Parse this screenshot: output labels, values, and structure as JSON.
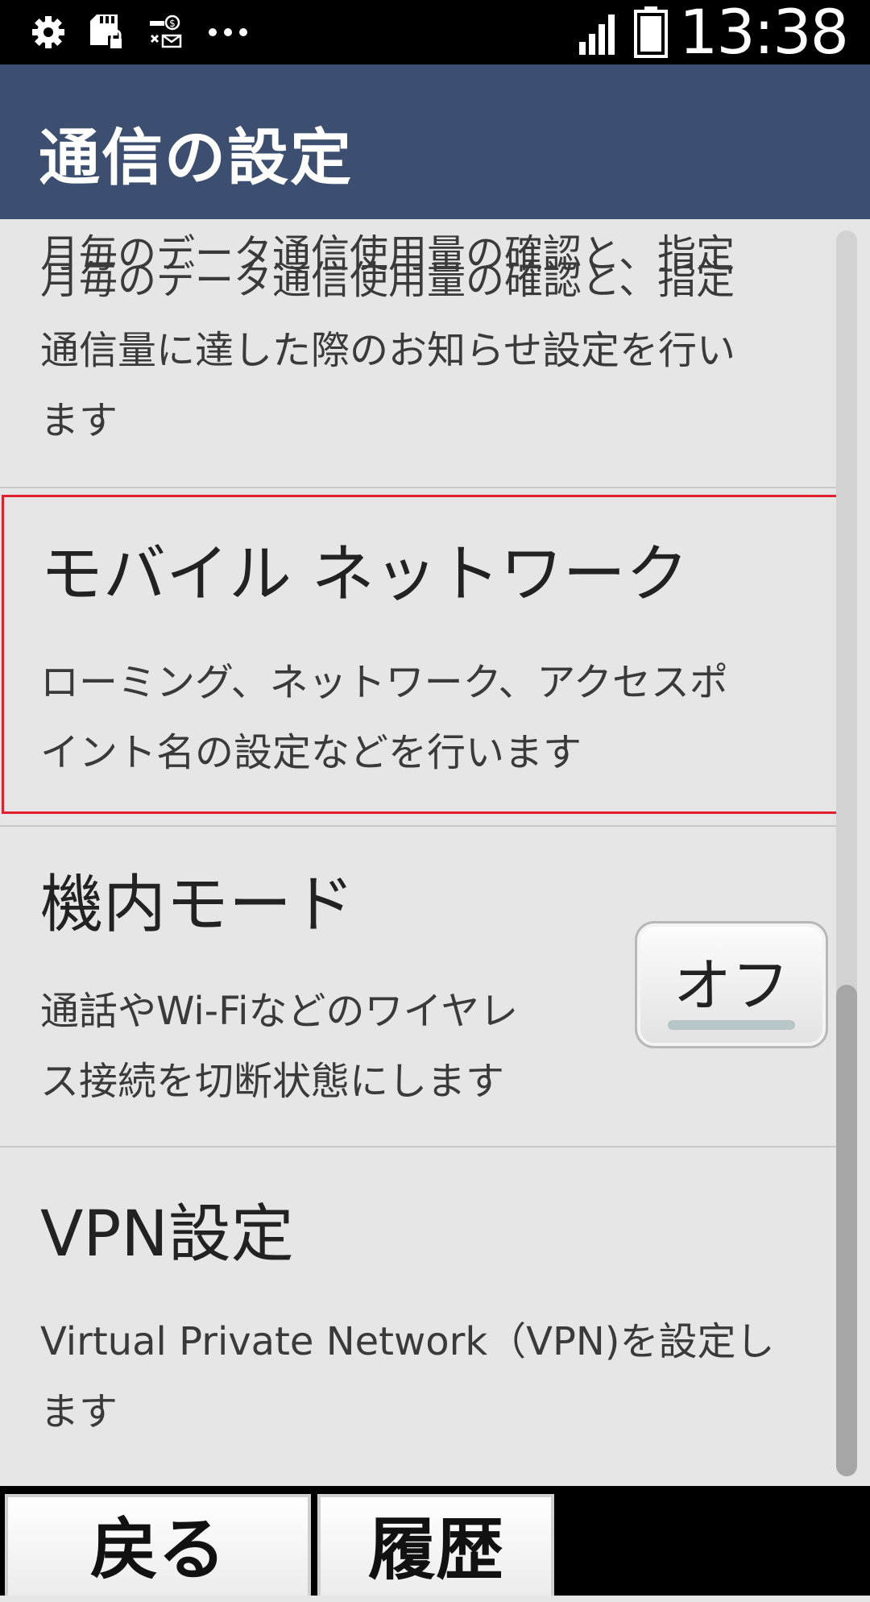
{
  "status_bar": {
    "time": "13:38",
    "icons": [
      "gear-icon",
      "sd-card-lock-icon",
      "key-money-icon",
      "more-dots-icon",
      "signal-icon",
      "battery-icon"
    ]
  },
  "header": {
    "title": "通信の設定"
  },
  "items": [
    {
      "desc_line1": "月毎のデータ通信使用量の確認と、指定",
      "desc_line2": "通信量に達した際のお知らせ設定を行い",
      "desc_line3": "ます"
    },
    {
      "title": "モバイル ネットワーク",
      "desc_line1": "ローミング、ネットワーク、アクセスポ",
      "desc_line2": "イント名の設定などを行います"
    },
    {
      "title": "機内モード",
      "desc_line1": "通話やWi-Fiなどのワイヤレ",
      "desc_line2": "ス接続を切断状態にします",
      "toggle_label": "オフ"
    },
    {
      "title": "VPN設定",
      "desc_line1": "Virtual Private Network（VPN)を設定し",
      "desc_line2": "ます"
    }
  ],
  "bottom_bar": {
    "back_label": "戻る",
    "history_label": "履歴"
  },
  "colors": {
    "header_bg": "#3d4f70",
    "highlight": "#e0202a",
    "list_bg": "#e6e6e6"
  }
}
